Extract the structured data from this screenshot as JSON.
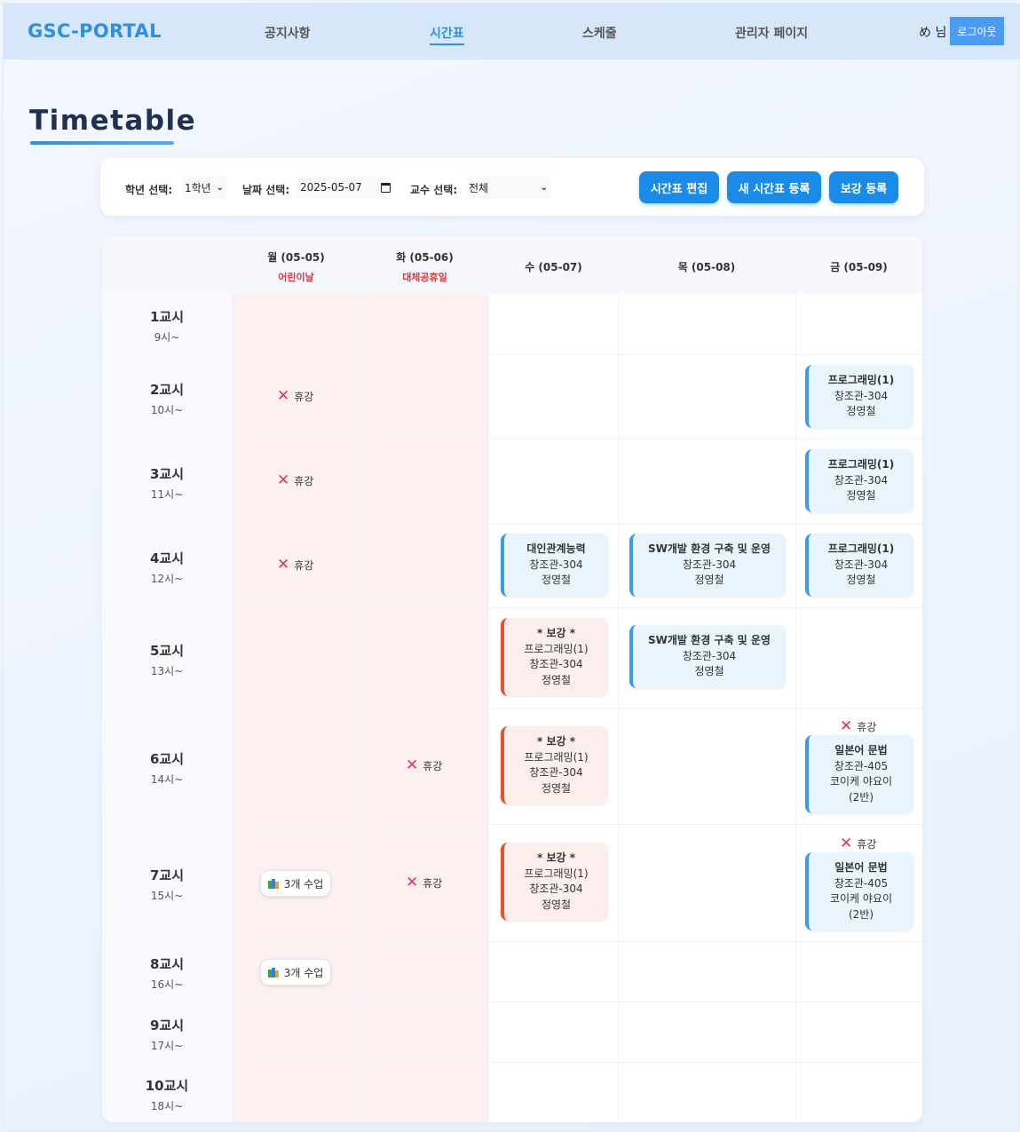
{
  "nav": {
    "logo": "GSC-PORTAL",
    "links": [
      "공지사항",
      "시간표",
      "스케줄",
      "관리자 페이지"
    ],
    "active": "시간표",
    "user": "め 님",
    "logout": "로그아웃"
  },
  "page": {
    "title": "Timetable"
  },
  "filters": {
    "grade_label": "학년 선택:",
    "grade_value": "1학년",
    "date_label": "날짜 선택:",
    "date_value": "2025-05-07",
    "prof_label": "교수 선택:",
    "prof_value": "전체",
    "btn_edit": "시간표 편집",
    "btn_new": "새 시간표 등록",
    "btn_makeup": "보강 등록"
  },
  "days": [
    {
      "label": "월 (05-05)",
      "holiday": "어린이날"
    },
    {
      "label": "화 (05-06)",
      "holiday": "대체공휴일"
    },
    {
      "label": "수 (05-07)",
      "holiday": ""
    },
    {
      "label": "목 (05-08)",
      "holiday": ""
    },
    {
      "label": "금 (05-09)",
      "holiday": ""
    }
  ],
  "periods": [
    {
      "name": "1교시",
      "time": "9시~"
    },
    {
      "name": "2교시",
      "time": "10시~"
    },
    {
      "name": "3교시",
      "time": "11시~"
    },
    {
      "name": "4교시",
      "time": "12시~"
    },
    {
      "name": "5교시",
      "time": "13시~"
    },
    {
      "name": "6교시",
      "time": "14시~"
    },
    {
      "name": "7교시",
      "time": "15시~"
    },
    {
      "name": "8교시",
      "time": "16시~"
    },
    {
      "name": "9교시",
      "time": "17시~"
    },
    {
      "name": "10교시",
      "time": "18시~"
    }
  ],
  "cancel_label": "휴강",
  "makeup_tag": "* 보강 *",
  "class_count": "3개 수업",
  "courses": {
    "prog": {
      "name": "프로그래밍(1)",
      "room": "창조관-304",
      "prof": "정영철"
    },
    "interp": {
      "name": "대인관계능력",
      "room": "창조관-304",
      "prof": "정영철"
    },
    "sw": {
      "name": "SW개발 환경 구축 및 운영",
      "room": "창조관-304",
      "prof": "정영철"
    },
    "jp": {
      "name": "일본어 문법",
      "room": "창조관-405",
      "prof": "코이케 야요이",
      "section": "(2반)"
    }
  }
}
